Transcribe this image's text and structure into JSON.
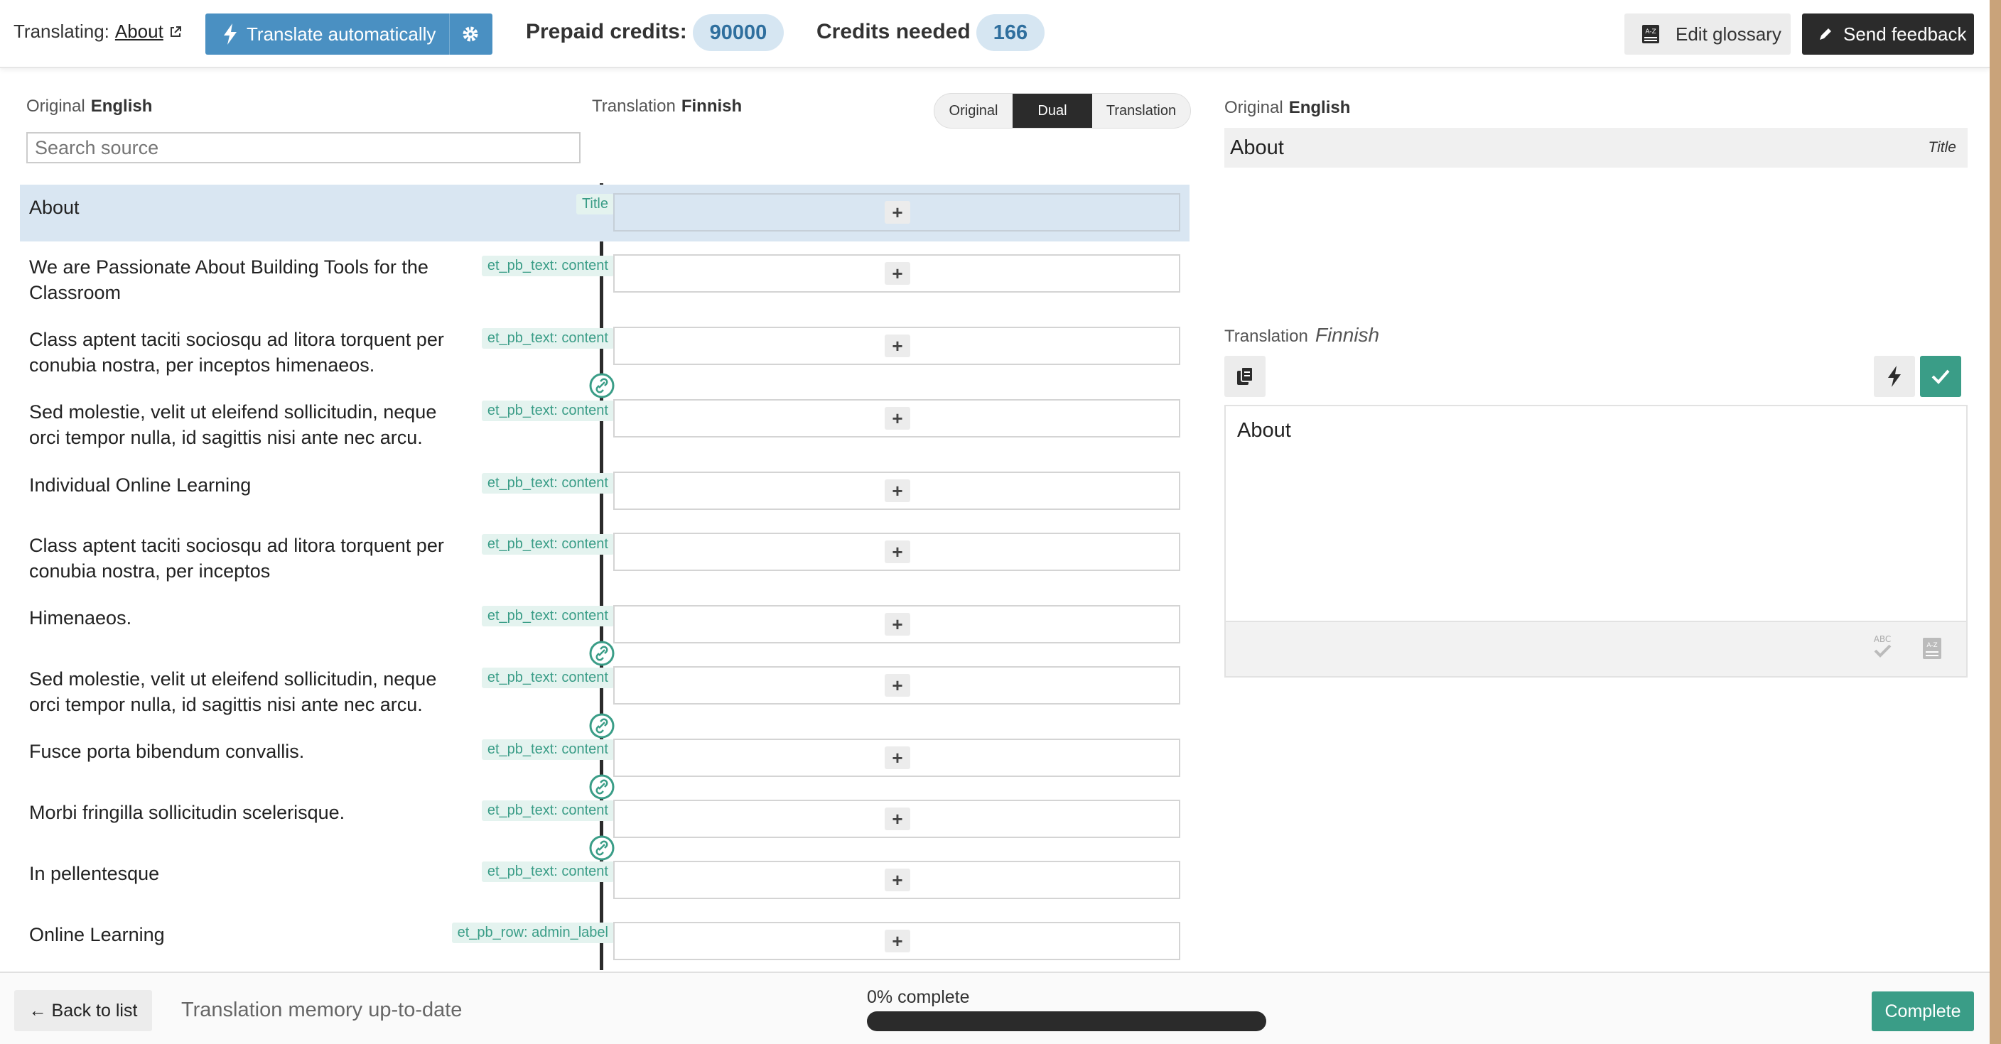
{
  "topbar": {
    "translating_label": "Translating:",
    "page_link": "About",
    "translate_auto_label": "Translate automatically",
    "prepaid_label": "Prepaid credits:",
    "prepaid_value": "90000",
    "needed_label": "Credits needed",
    "needed_value": "166",
    "glossary_label": "Edit glossary",
    "feedback_label": "Send feedback"
  },
  "columns": {
    "original_label": "Original",
    "original_lang": "English",
    "translation_label": "Translation",
    "translation_lang": "Finnish",
    "search_placeholder": "Search source",
    "view_modes": [
      "Original",
      "Dual",
      "Translation"
    ],
    "active_view": "Dual"
  },
  "segments": [
    {
      "text": "About",
      "tag": "Title",
      "active": true
    },
    {
      "text": "We are Passionate About Building Tools for the Classroom",
      "tag": "et_pb_text: content"
    },
    {
      "text": "Class aptent taciti sociosqu ad litora torquent per conubia nostra, per inceptos himenaeos.",
      "tag": "et_pb_text: content",
      "linked_after": true
    },
    {
      "text": "Sed molestie, velit ut eleifend sollicitudin, neque orci tempor nulla, id sagittis nisi ante nec arcu.",
      "tag": "et_pb_text: content"
    },
    {
      "text": "Individual Online Learning",
      "tag": "et_pb_text: content"
    },
    {
      "text": "Class aptent taciti sociosqu ad litora torquent per conubia nostra, per inceptos",
      "tag": "et_pb_text: content"
    },
    {
      "text": "Himenaeos.",
      "tag": "et_pb_text: content",
      "linked_after": true
    },
    {
      "text": "Sed molestie, velit ut eleifend sollicitudin, neque orci tempor nulla, id sagittis nisi ante nec arcu.",
      "tag": "et_pb_text: content",
      "linked_after": true
    },
    {
      "text": "Fusce porta bibendum convallis.",
      "tag": "et_pb_text: content",
      "linked_after": true
    },
    {
      "text": "Morbi fringilla sollicitudin scelerisque.",
      "tag": "et_pb_text: content",
      "linked_after": true
    },
    {
      "text": "In pellentesque",
      "tag": "et_pb_text: content"
    },
    {
      "text": "Online Learning",
      "tag": "et_pb_row: admin_label"
    }
  ],
  "add_symbol": "+",
  "detail": {
    "original_label": "Original",
    "original_lang": "English",
    "source_text": "About",
    "source_tag": "Title",
    "translation_label": "Translation",
    "translation_lang": "Finnish",
    "editor_text": "About"
  },
  "bottombar": {
    "back_label": "← Back to list",
    "tm_status": "Translation memory up-to-date",
    "progress_label": "0% complete",
    "progress_percent": 0,
    "complete_label": "Complete"
  },
  "colors": {
    "accent_blue": "#4a90c2",
    "accent_green": "#3a9d87",
    "dark": "#2b2b2b",
    "active_row": "#d9e6f2"
  },
  "icons": {
    "external_link": "external-link-icon",
    "bolt": "bolt-icon",
    "gear": "gear-icon",
    "glossary": "glossary-icon",
    "pencil": "pencil-icon",
    "link": "link-icon",
    "copy": "copy-icon",
    "check": "check-icon",
    "spellcheck": "spellcheck-icon"
  }
}
